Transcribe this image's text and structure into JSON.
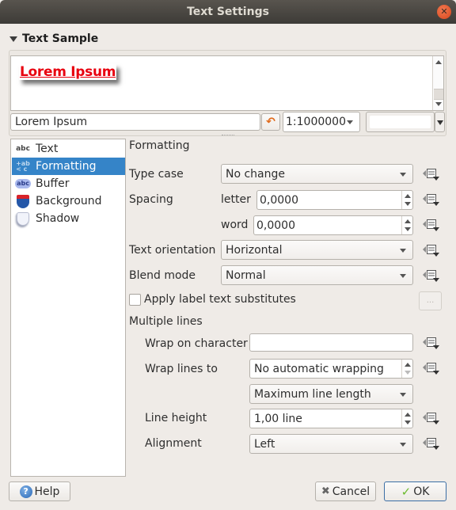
{
  "window": {
    "title": "Text Settings",
    "close_icon": "close-icon"
  },
  "sample": {
    "header": "Text Sample",
    "preview_text": "Lorem Ipsum",
    "preview_color": "#e8000f",
    "text_value": "Lorem Ipsum",
    "scale_value": "1:1000000",
    "background_color": "#ffffff"
  },
  "sidebar": {
    "items": [
      {
        "label": "Text",
        "icon": "text-abc-icon",
        "selected": false
      },
      {
        "label": "Formatting",
        "icon": "formatting-icon",
        "selected": true
      },
      {
        "label": "Buffer",
        "icon": "buffer-icon",
        "selected": false
      },
      {
        "label": "Background",
        "icon": "background-shield-icon",
        "selected": false
      },
      {
        "label": "Shadow",
        "icon": "shadow-shield-icon",
        "selected": false
      }
    ],
    "selected_color": "#3584c8"
  },
  "formatting": {
    "title": "Formatting",
    "type_case": {
      "label": "Type case",
      "value": "No change"
    },
    "spacing": {
      "label": "Spacing",
      "letter_label": "letter",
      "letter_value": "0,0000",
      "word_label": "word",
      "word_value": "0,0000"
    },
    "text_orientation": {
      "label": "Text orientation",
      "value": "Horizontal"
    },
    "blend_mode": {
      "label": "Blend mode",
      "value": "Normal"
    },
    "apply_substitutes": {
      "label": "Apply label text substitutes",
      "checked": false,
      "button_label": "..."
    },
    "multiple_lines": {
      "title": "Multiple lines",
      "wrap_on_character": {
        "label": "Wrap on character",
        "value": ""
      },
      "wrap_lines_to": {
        "label": "Wrap lines to",
        "value": "No automatic wrapping"
      },
      "wrap_mode": {
        "value": "Maximum line length"
      },
      "line_height": {
        "label": "Line height",
        "value": "1,00 line"
      },
      "alignment": {
        "label": "Alignment",
        "value": "Left"
      }
    }
  },
  "buttons": {
    "help": "Help",
    "cancel": "Cancel",
    "ok": "OK"
  }
}
